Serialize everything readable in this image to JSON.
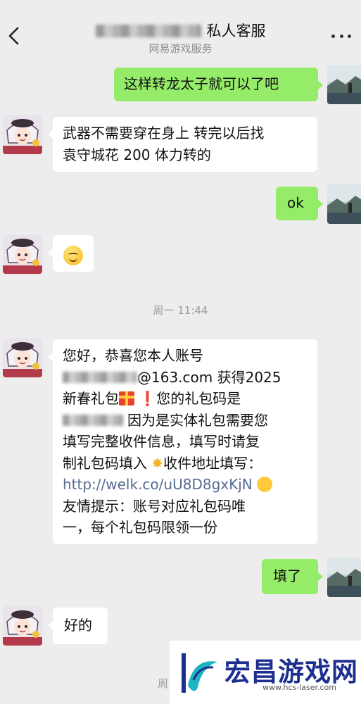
{
  "header": {
    "title": "私人客服",
    "subtitle": "网易游戏服务",
    "back_icon": "chevron-left-icon",
    "more_icon": "more-dots-icon"
  },
  "messages": [
    {
      "from": "me",
      "text": "这样转龙太子就可以了吧"
    },
    {
      "from": "them",
      "line1": "武器不需要穿在身上 转完以后找",
      "line2": "袁守城花 200 体力转的"
    },
    {
      "from": "me",
      "text": "ok"
    },
    {
      "from": "them",
      "emoji": "smiling-face-emoji"
    },
    {
      "from": "them",
      "line1": "您好，恭喜您本人账号",
      "line2_suffix": "@163.com 获得2025",
      "line3a": "新春礼包",
      "line3b": "您的礼包码是",
      "line4": "因为是实体礼包需要您",
      "line5": "填写完整收件信息，填写时请复",
      "line6": "制礼包码填入",
      "line6b": "收件地址填写：",
      "link": "http://welk.co/uU8D8gxKjN",
      "line8": "友情提示：账号对应礼包码唯",
      "line9": "一，每个礼包码限领一份"
    },
    {
      "from": "me",
      "text": "填了"
    },
    {
      "from": "them",
      "text": "好的"
    }
  ],
  "timestamps": [
    "周一 11:44",
    "周"
  ],
  "watermark": {
    "text": "宏昌游戏网",
    "url": "www.hcs-laser.com"
  },
  "colors": {
    "background": "#ededed",
    "my_bubble": "#95ec69",
    "their_bubble": "#ffffff",
    "link": "#576b95"
  }
}
